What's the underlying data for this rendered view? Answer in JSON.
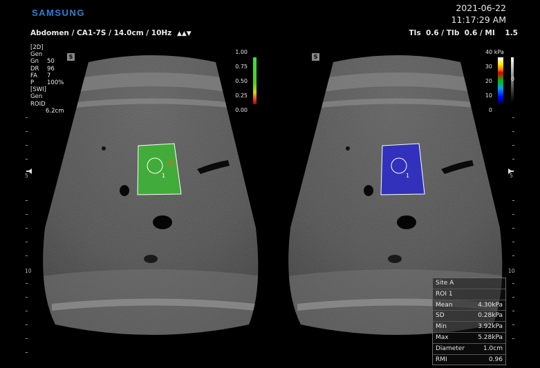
{
  "header": {
    "brand": "SAMSUNG",
    "date": "2021-06-22",
    "time": "11:17:29 AM",
    "exam_info": "Abdomen / CA1-7S / 14.0cm / 10Hz",
    "thermal_index": "TIs  0.6 / TIb  0.6 / MI    1.5"
  },
  "params": {
    "mode_2d": "[2D]",
    "gen_2d": "Gen",
    "rows": [
      {
        "k": "Gn",
        "v": "50"
      },
      {
        "k": "DR",
        "v": "96"
      },
      {
        "k": "FA",
        "v": "7"
      },
      {
        "k": "P",
        "v": "100%"
      }
    ],
    "mode_swi": "[SWI]",
    "gen_swi": "Gen",
    "roid_label": "ROID",
    "roid_value": "6.2cm"
  },
  "left_panel": {
    "marker": "S",
    "scale_ticks": [
      "1.00",
      "0.75",
      "0.50",
      "0.25",
      "0.00"
    ],
    "roi_label": "1"
  },
  "right_panel": {
    "marker": "S",
    "scale_unit_label": "40 kPa",
    "scale_ticks": [
      "30",
      "20",
      "10",
      "0"
    ],
    "gray_label": "0",
    "roi_label": "1"
  },
  "depth_labels": [
    "5",
    "10"
  ],
  "measurement": {
    "site": "Site A",
    "roi": "ROI 1",
    "rows": [
      {
        "label": "Mean",
        "value": "4.30kPa"
      },
      {
        "label": "SD",
        "value": "0.28kPa"
      },
      {
        "label": "Min",
        "value": "3.92kPa"
      },
      {
        "label": "Max",
        "value": "5.28kPa"
      },
      {
        "label": "Diameter",
        "value": "1.0cm"
      },
      {
        "label": "RMI",
        "value": "0.96"
      }
    ]
  },
  "colors": {
    "brand": "#2d7fd6",
    "roi_green": "#3cb832",
    "roi_blue": "#2a2ac8"
  }
}
